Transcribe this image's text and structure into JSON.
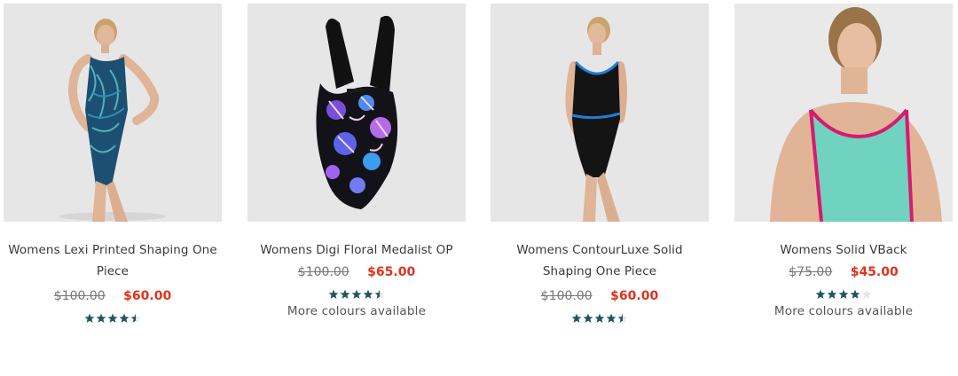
{
  "products": [
    {
      "name": "Womens Lexi Printed Shaping One Piece",
      "was_price": "$100.00",
      "sale_price": "$60.00",
      "rating": 4.5,
      "more_colours": ""
    },
    {
      "name": "Womens Digi Floral Medalist OP",
      "was_price": "$100.00",
      "sale_price": "$65.00",
      "rating": 4.5,
      "more_colours": "More colours available"
    },
    {
      "name": "Womens ContourLuxe Solid Shaping One Piece",
      "was_price": "$100.00",
      "sale_price": "$60.00",
      "rating": 4.5,
      "more_colours": ""
    },
    {
      "name": "Womens Solid VBack",
      "was_price": "$75.00",
      "sale_price": "$45.00",
      "rating": 4,
      "more_colours": "More colours available"
    }
  ],
  "colors": {
    "star": "#1f5661",
    "star_empty": "#e4e4e4",
    "sale": "#e0321c",
    "thumb_bg": "#e6e6e6"
  }
}
